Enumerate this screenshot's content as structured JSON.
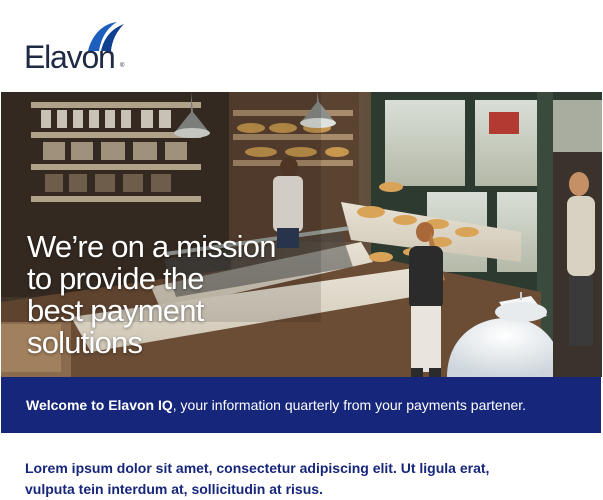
{
  "header": {
    "logo_text": "Elavon",
    "logo_mark": "®"
  },
  "hero": {
    "headline_lines": [
      "We’re on a mission",
      "to provide the",
      "best payment",
      "solutions"
    ],
    "image_subject": "bakery-counter-photo"
  },
  "welcome": {
    "bold": "Welcome to Elavon IQ",
    "rest": ", your information quarterly from your payments partener."
  },
  "intro": {
    "lines": [
      "Lorem ipsum dolor sit amet, consectetur adipiscing elit. Ut ligula erat,",
      "vulputa tein interdum at, sollicitudin at risus."
    ]
  },
  "colors": {
    "brand_navy": "#16267b",
    "logo_blue": "#1d5fbf",
    "logo_text": "#1f2a44",
    "text_white": "#ffffff"
  }
}
